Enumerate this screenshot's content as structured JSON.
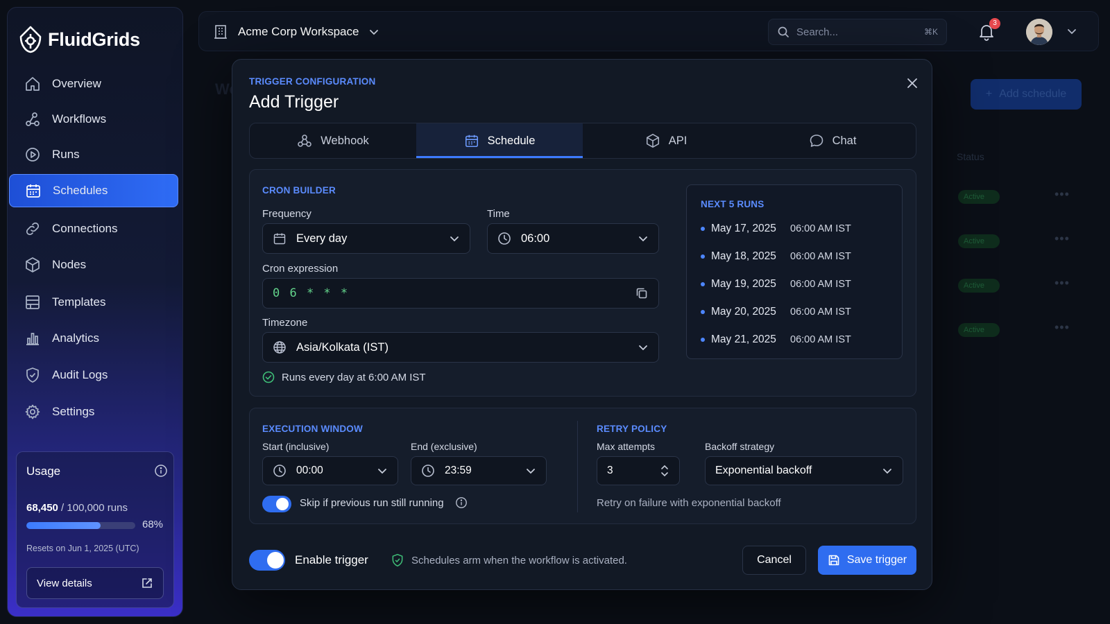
{
  "app": {
    "name": "FluidGrids"
  },
  "sidebar": {
    "items": [
      {
        "label": "Overview",
        "icon": "home-icon"
      },
      {
        "label": "Workflows",
        "icon": "workflow-icon"
      },
      {
        "label": "Runs",
        "icon": "play-circle-icon"
      },
      {
        "label": "Schedules",
        "icon": "calendar-icon",
        "active": true
      },
      {
        "label": "Connections",
        "icon": "link-icon"
      },
      {
        "label": "Nodes",
        "icon": "cube-icon"
      },
      {
        "label": "Templates",
        "icon": "template-icon"
      },
      {
        "label": "Analytics",
        "icon": "bar-chart-icon"
      },
      {
        "label": "Audit Logs",
        "icon": "shield-check-icon"
      },
      {
        "label": "Settings",
        "icon": "gear-icon"
      }
    ],
    "usage": {
      "title": "Usage",
      "used": "68,450",
      "limit_text": " / 100,000 runs",
      "percent_label": "68%",
      "fraction": 0.68,
      "resets": "Resets on Jun 1, 2025 (UTC)",
      "button": "View details"
    }
  },
  "topbar": {
    "workspace": "Acme Corp Workspace",
    "search_placeholder": "Search...",
    "search_shortcut": "⌘K",
    "notification_count": "3"
  },
  "background": {
    "add_button": "Add schedule",
    "status_header": "Status",
    "badge": "Active"
  },
  "modal": {
    "eyebrow": "TRIGGER CONFIGURATION",
    "title": "Add Trigger",
    "tabs": [
      {
        "label": "Webhook",
        "icon": "webhook-icon"
      },
      {
        "label": "Schedule",
        "icon": "calendar-icon",
        "active": true
      },
      {
        "label": "API",
        "icon": "cube-icon"
      },
      {
        "label": "Chat",
        "icon": "chat-bubble-icon"
      }
    ],
    "cron": {
      "section": "CRON BUILDER",
      "frequency_label": "Frequency",
      "frequency_value": "Every day",
      "time_label": "Time",
      "time_value": "06:00",
      "expression_label": "Cron expression",
      "expression_value": "0 6 * * *",
      "timezone_label": "Timezone",
      "timezone_value": "Asia/Kolkata (IST)",
      "summary": "Runs every day at 6:00 AM IST"
    },
    "next_runs": {
      "title": "NEXT 5 RUNS",
      "items": [
        {
          "date": "May 17, 2025",
          "time": "06:00 AM IST"
        },
        {
          "date": "May 18, 2025",
          "time": "06:00 AM IST"
        },
        {
          "date": "May 19, 2025",
          "time": "06:00 AM IST"
        },
        {
          "date": "May 20, 2025",
          "time": "06:00 AM IST"
        },
        {
          "date": "May 21, 2025",
          "time": "06:00 AM IST"
        }
      ]
    },
    "window": {
      "section": "EXECUTION WINDOW",
      "start_label": "Start (inclusive)",
      "start_value": "00:00",
      "end_label": "End (exclusive)",
      "end_value": "23:59",
      "skip_label": "Skip if previous run still running",
      "skip_enabled": true
    },
    "retry": {
      "section": "RETRY POLICY",
      "max_label": "Max attempts",
      "max_value": "3",
      "backoff_label": "Backoff strategy",
      "backoff_value": "Exponential backoff",
      "hint": "Retry on failure with exponential backoff"
    },
    "footer": {
      "enable_label": "Enable trigger",
      "enabled": true,
      "note": "Schedules arm when the workflow is activated.",
      "cancel": "Cancel",
      "save": "Save trigger"
    }
  },
  "colors": {
    "accent": "#2f6df0",
    "accent_text": "#5b8cff",
    "success": "#3fbf78",
    "cron_text": "#63d38b",
    "badge": "#e5484d"
  }
}
